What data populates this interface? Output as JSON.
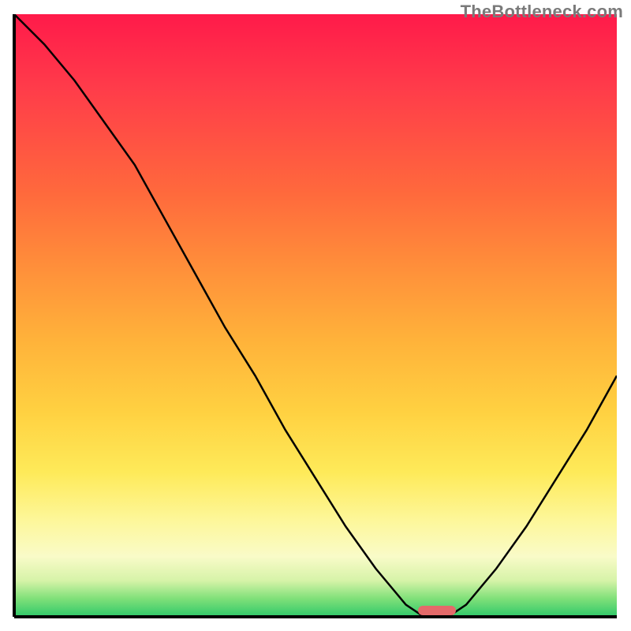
{
  "watermark": "TheBottleneck.com",
  "colors": {
    "axis": "#000000",
    "curve": "#000000",
    "marker": "#e46a6a",
    "gradient_top": "#ff1a4a",
    "gradient_bottom": "#2fc96a"
  },
  "chart_data": {
    "type": "line",
    "title": "",
    "xlabel": "",
    "ylabel": "",
    "xlim": [
      0,
      100
    ],
    "ylim": [
      0,
      100
    ],
    "grid": false,
    "legend": false,
    "background": "vertical-gradient red-to-green",
    "x": [
      0,
      5,
      10,
      15,
      20,
      25,
      30,
      35,
      40,
      45,
      50,
      55,
      60,
      65,
      68,
      72,
      75,
      80,
      85,
      90,
      95,
      100
    ],
    "values": [
      100,
      95,
      89,
      82,
      75,
      66,
      57,
      48,
      40,
      31,
      23,
      15,
      8,
      2,
      0,
      0,
      2,
      8,
      15,
      23,
      31,
      40
    ],
    "marker": {
      "x_start": 67,
      "x_end": 74,
      "y": 0
    },
    "notes": "Single V-shaped bottleneck curve over a heatmap-gradient background; minimum (optimal match) around x≈70."
  }
}
